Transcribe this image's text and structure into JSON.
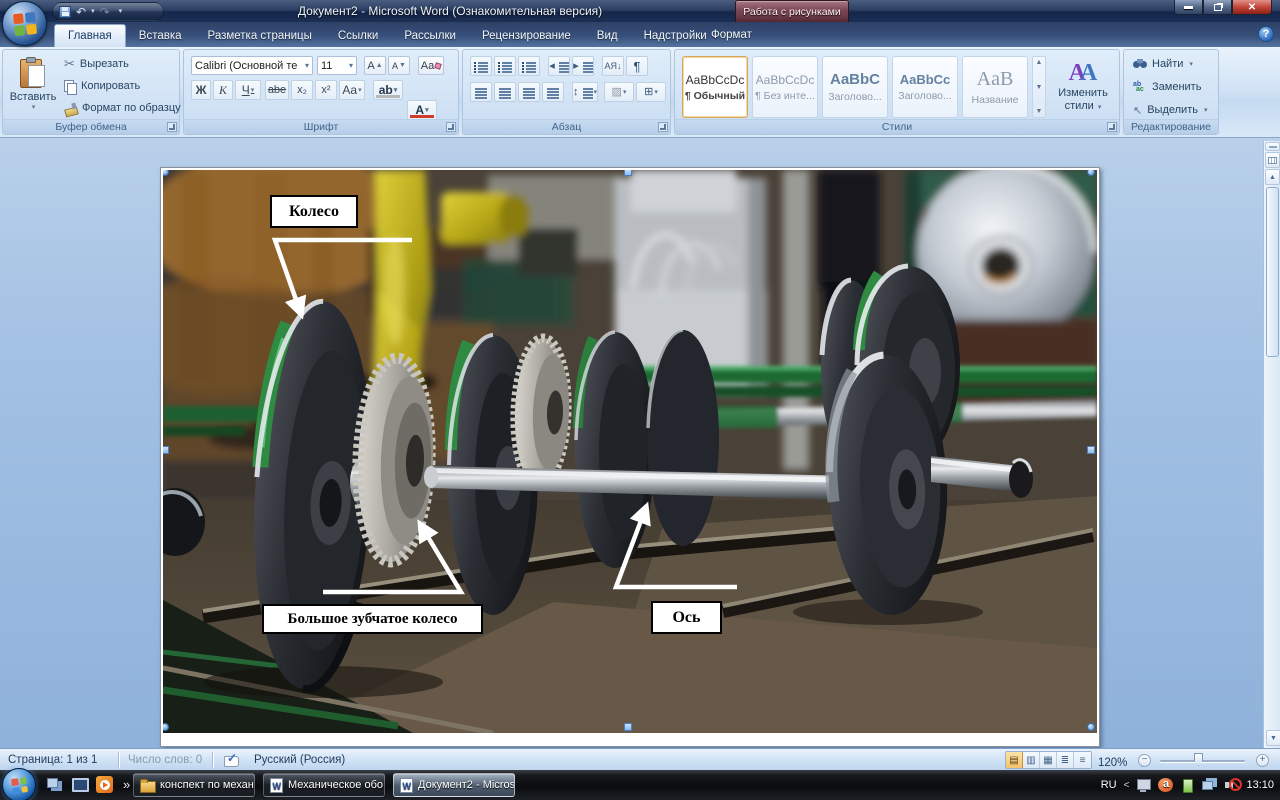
{
  "window": {
    "title": "Документ2 - Microsoft Word (Ознакомительная версия)",
    "contextual_group": "Работа с рисунками"
  },
  "icons": {
    "close": "✕",
    "help": "?",
    "undo": "↶",
    "redo": "↷",
    "dropdown": "▾",
    "up_arrow": "▲",
    "down_arrow": "▼",
    "quick_launch_overflow": "»",
    "pilcrow": "¶",
    "sort": "АЯ↓",
    "select_cursor": "↖",
    "tray_expand": "<",
    "view_print": "▤",
    "view_reading": "▥",
    "view_web": "▦",
    "view_outline": "≣",
    "view_draft": "≡",
    "minus": "−",
    "plus": "+"
  },
  "tabs": [
    {
      "label": "Главная"
    },
    {
      "label": "Вставка"
    },
    {
      "label": "Разметка страницы"
    },
    {
      "label": "Ссылки"
    },
    {
      "label": "Рассылки"
    },
    {
      "label": "Рецензирование"
    },
    {
      "label": "Вид"
    },
    {
      "label": "Надстройки"
    },
    {
      "label": "Формат"
    }
  ],
  "ribbon": {
    "clipboard": {
      "title": "Буфер обмена",
      "paste": "Вставить",
      "cut": "Вырезать",
      "copy": "Копировать",
      "format_painter": "Формат по образцу",
      "cut_glyph": "✂"
    },
    "font": {
      "title": "Шрифт",
      "name": "Calibri (Основной те",
      "size": "11",
      "bold": "Ж",
      "italic": "К",
      "underline": "Ч",
      "strikethrough": "abe",
      "subscript": "x₂",
      "superscript": "x²",
      "change_case": "Aa",
      "grow": "А",
      "shrink": "А",
      "highlight": "ab",
      "color": "А"
    },
    "paragraph": {
      "title": "Абзац"
    },
    "styles": {
      "title": "Стили",
      "change": "Изменить стили",
      "items": [
        {
          "preview": "AaBbCcDc",
          "name": "¶ Обычный"
        },
        {
          "preview": "AaBbCcDc",
          "name": "¶ Без инте..."
        },
        {
          "preview": "AaBbC",
          "name": "Заголово..."
        },
        {
          "preview": "AaBbCc",
          "name": "Заголово..."
        },
        {
          "preview": "AaB",
          "name": "Название"
        }
      ]
    },
    "editing": {
      "title": "Редактирование",
      "find": "Найти",
      "replace": "Заменить",
      "select": "Выделить"
    }
  },
  "photo_labels": {
    "wheel": "Колесо",
    "gear": "Большое зубчатое колесо",
    "axle": "Ось"
  },
  "status_bar": {
    "page": "Страница: 1 из 1",
    "words": "Число слов: 0",
    "language": "Русский (Россия)",
    "zoom": "120%"
  },
  "taskbar": {
    "buttons": [
      {
        "label": "конспект по механ..."
      },
      {
        "label": "Механическое обо..."
      },
      {
        "label": "Документ2 - Micros..."
      }
    ],
    "tray": {
      "lang": "RU",
      "time": "13:10"
    }
  }
}
